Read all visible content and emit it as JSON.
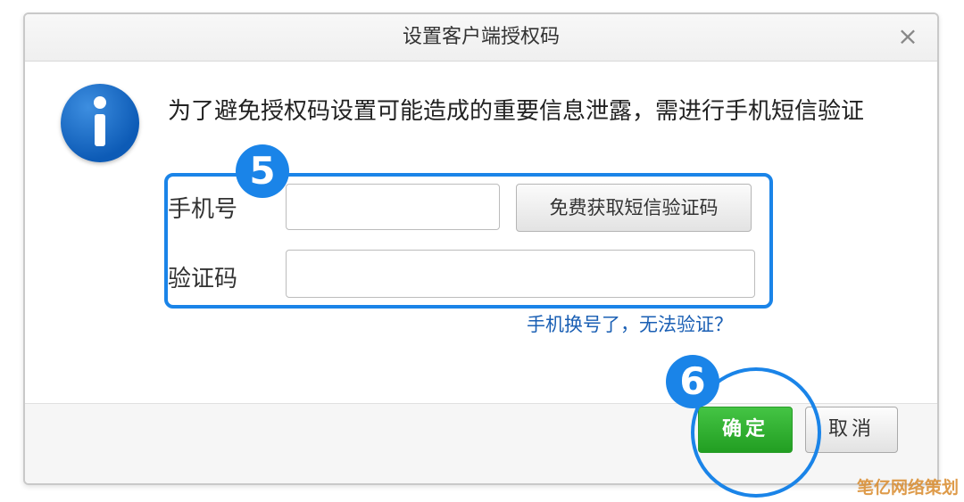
{
  "dialog": {
    "title": "设置客户端授权码",
    "close_glyph": "×",
    "message": "为了避免授权码设置可能造成的重要信息泄露，需进行手机短信验证",
    "form": {
      "phone_label": "手机号",
      "phone_value": "",
      "sms_button": "免费获取短信验证码",
      "code_label": "验证码",
      "code_value": ""
    },
    "changed_phone_link": "手机换号了，无法验证？",
    "ok_button": "确定",
    "cancel_button": "取消"
  },
  "annotations": {
    "step5": "5",
    "step6": "6"
  },
  "watermark": "笔亿网络策划",
  "colors": {
    "accent_blue": "#1a84e8",
    "ok_green": "#2aa52a",
    "link_blue": "#1a5fb4",
    "watermark_orange": "#d98a2b"
  }
}
